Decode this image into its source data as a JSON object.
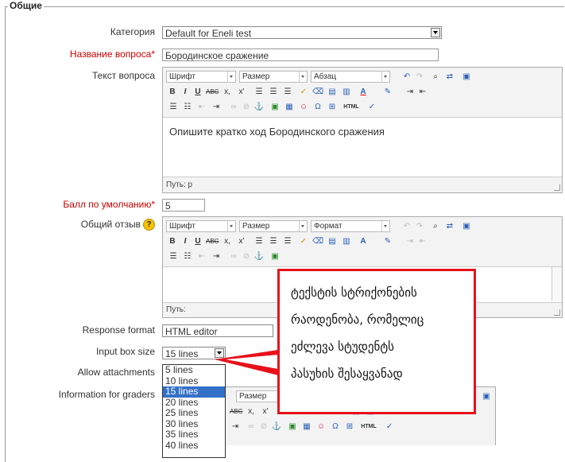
{
  "section": {
    "title": "Общие"
  },
  "fields": {
    "category": {
      "label": "Категория",
      "value": "Default for Eneli test"
    },
    "question_name": {
      "label": "Название вопроса",
      "value": "Бородинское сражение"
    },
    "question_text": {
      "label": "Текст вопроса",
      "content": "Опишите кратко ход Бородинского сражения",
      "path": "Путь: p"
    },
    "default_mark": {
      "label": "Балл по умолчанию",
      "value": "5"
    },
    "general_feedback": {
      "label": "Общий отзыв",
      "path": "Путь:"
    },
    "response_format": {
      "label": "Response format",
      "value": "HTML editor"
    },
    "input_box_size": {
      "label": "Input box size",
      "value": "15 lines"
    },
    "allow_attachments": {
      "label": "Allow attachments"
    },
    "info_graders": {
      "label": "Information for graders"
    }
  },
  "required_marker": "*",
  "editor_toolbar": {
    "font": "Шрифт",
    "size": "Размер",
    "paragraph": "Абзац",
    "format": "Формат",
    "bold": "B",
    "italic": "I",
    "underline": "U",
    "strike": "ABC",
    "subscript": "x,",
    "superscript": "x'",
    "html": "HTML"
  },
  "input_box_options": [
    "5 lines",
    "10 lines",
    "15 lines",
    "20 lines",
    "25 lines",
    "30 lines",
    "35 lines",
    "40 lines"
  ],
  "selected_option_index": 2,
  "callout": {
    "lines": [
      "ტექსტის სტრიქონების",
      "რაოდენობა, რომელიც",
      "ეძლევა სტუდენტს",
      "პასუხის შესაყვანად"
    ],
    "border_color": "#e8111b"
  },
  "colors": {
    "required_label": "#cc0000",
    "selection": "#3370c8"
  }
}
